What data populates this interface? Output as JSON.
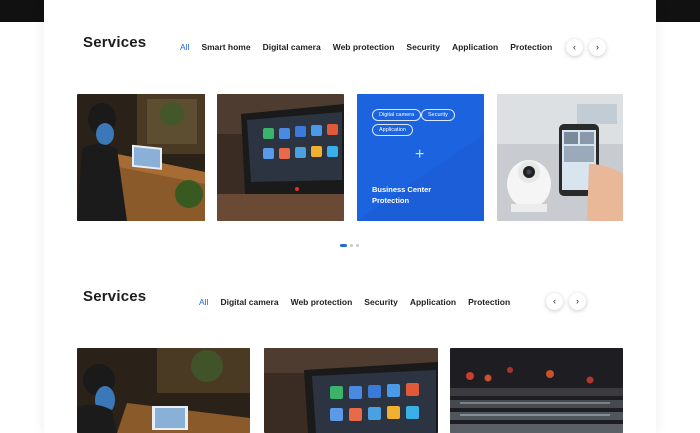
{
  "section1": {
    "title": "Services",
    "tabs": [
      "All",
      "Smart home",
      "Digital camera",
      "Web protection",
      "Security",
      "Application",
      "Protection"
    ],
    "prev_icon": "chevron-left-icon",
    "next_icon": "chevron-right-icon",
    "featured_card": {
      "chips": [
        "Digital camera",
        "Security",
        "Application"
      ],
      "title_line1": "Business Center",
      "title_line2": "Protection"
    },
    "pagination": {
      "count": 3,
      "active": 1
    }
  },
  "section2": {
    "title": "Services",
    "tabs": [
      "All",
      "Digital camera",
      "Web protection",
      "Security",
      "Application",
      "Protection"
    ],
    "prev_icon": "chevron-left-icon",
    "next_icon": "chevron-right-icon"
  },
  "colors": {
    "accent": "#1e6ad6",
    "card_blue": "#1c63e0",
    "text": "#1c1c1c"
  }
}
